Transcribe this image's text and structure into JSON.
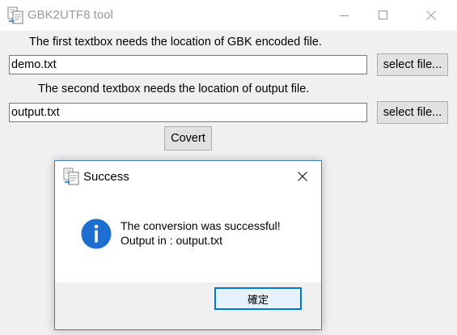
{
  "window": {
    "title": "GBK2UTF8 tool"
  },
  "main": {
    "instruction_1": "The first textbox needs the location of GBK encoded file.",
    "input_file_value": "demo.txt",
    "select_file_label_1": "select file...",
    "instruction_2": "The second textbox needs the location of output file.",
    "output_file_value": "output.txt",
    "select_file_label_2": "select file...",
    "convert_label": "Covert"
  },
  "dialog": {
    "title": "Success",
    "message_line_1": "The conversion was successful!",
    "message_line_2": "Output in : output.txt",
    "ok_label": "確定"
  },
  "icons": {
    "app": "document-convert-icon",
    "info": "information-icon"
  },
  "colors": {
    "info_blue": "#1c6fd1",
    "dialog_border": "#3f7fbf",
    "ok_border": "#0078d7"
  }
}
